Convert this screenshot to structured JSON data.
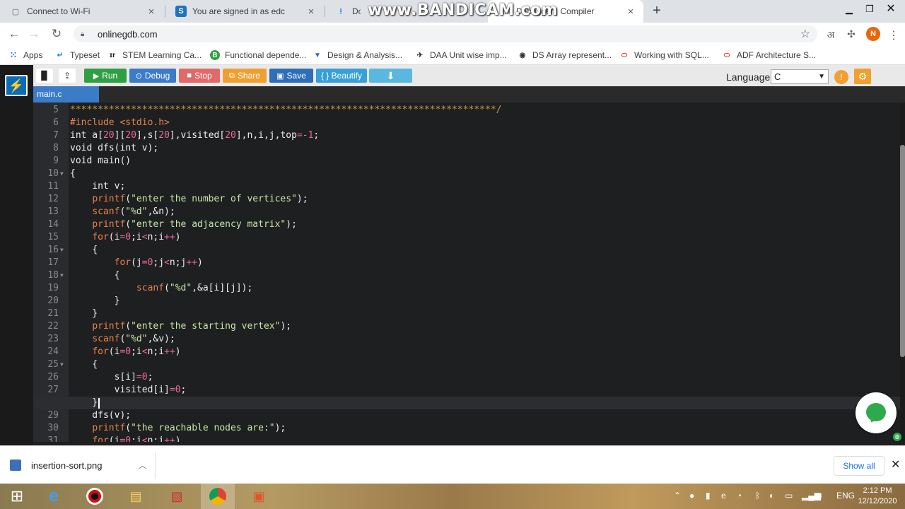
{
  "browser": {
    "tabs": [
      {
        "title": "Connect to Wi-Fi",
        "icon": "wifi-page-icon"
      },
      {
        "title": "You are signed in as edc",
        "icon": "s-logo-icon"
      },
      {
        "title": "Down",
        "icon": "download-icon"
      },
      {
        "title": "line Debugger | Compiler",
        "icon": "onlinegdb-icon"
      }
    ],
    "new_tab": "+",
    "watermark": "www.BANDICAM.com",
    "url": "onlinegdb.com",
    "avatar_letter": "N",
    "bookmarks": [
      {
        "label": "Apps"
      },
      {
        "label": "Typeset"
      },
      {
        "label": "STEM Learning Ca..."
      },
      {
        "label": "Functional depende..."
      },
      {
        "label": "Design & Analysis..."
      },
      {
        "label": "DAA Unit wise imp..."
      },
      {
        "label": "DS Array represent..."
      },
      {
        "label": "Working with SQL..."
      },
      {
        "label": "ADF Architecture S..."
      }
    ]
  },
  "ide": {
    "toolbar": {
      "run": "Run",
      "debug": "Debug",
      "stop": "Stop",
      "share": "Share",
      "save": "Save",
      "beautify": "{ } Beautify"
    },
    "language_label": "Language",
    "language_value": "C",
    "file_tab": "main.c",
    "code_lines": [
      {
        "n": "5",
        "text": "*****************************************************************************/"
      },
      {
        "n": "6",
        "text": "#include <stdio.h>"
      },
      {
        "n": "7",
        "text": "int a[20][20],s[20],visited[20],n,i,j,top=-1;"
      },
      {
        "n": "8",
        "text": "void dfs(int v);"
      },
      {
        "n": "9",
        "text": "void main()"
      },
      {
        "n": "10",
        "text": "{"
      },
      {
        "n": "11",
        "text": "    int v;"
      },
      {
        "n": "12",
        "text": "    printf(\"enter the number of vertices\");"
      },
      {
        "n": "13",
        "text": "    scanf(\"%d\",&n);"
      },
      {
        "n": "14",
        "text": "    printf(\"enter the adjacency matrix\");"
      },
      {
        "n": "15",
        "text": "    for(i=0;i<n;i++)"
      },
      {
        "n": "16",
        "text": "    {"
      },
      {
        "n": "17",
        "text": "        for(j=0;j<n;j++)"
      },
      {
        "n": "18",
        "text": "        {"
      },
      {
        "n": "19",
        "text": "            scanf(\"%d\",&a[i][j]);"
      },
      {
        "n": "20",
        "text": "        }"
      },
      {
        "n": "21",
        "text": "    }"
      },
      {
        "n": "22",
        "text": "    printf(\"enter the starting vertex\");"
      },
      {
        "n": "23",
        "text": "    scanf(\"%d\",&v);"
      },
      {
        "n": "24",
        "text": "    for(i=0;i<n;i++)"
      },
      {
        "n": "25",
        "text": "    {"
      },
      {
        "n": "26",
        "text": "        s[i]=0;"
      },
      {
        "n": "27",
        "text": "        visited[i]=0;"
      },
      {
        "n": "28",
        "text": "    }"
      },
      {
        "n": "29",
        "text": "    dfs(v);"
      },
      {
        "n": "30",
        "text": "    printf(\"the reachable nodes are:\");"
      },
      {
        "n": "31",
        "text": "    for(i=0;i<n;i++)"
      }
    ]
  },
  "downloads": {
    "file": "insertion-sort.png",
    "show_all": "Show all"
  },
  "taskbar": {
    "lang": "ENG",
    "time": "2:12 PM",
    "date": "12/12/2020"
  },
  "colors": {
    "run": "#2ea043",
    "debug": "#3b7bc8",
    "stop": "#e06a6a",
    "share": "#f0a030",
    "save": "#2c6fb8",
    "beautify": "#38a0d8",
    "download": "#5ab8e0",
    "keyword_orange": "#e8834a",
    "string_green": "#c8e6a8",
    "number_pink": "#e86a9a",
    "comment_orange": "#c89a40"
  }
}
